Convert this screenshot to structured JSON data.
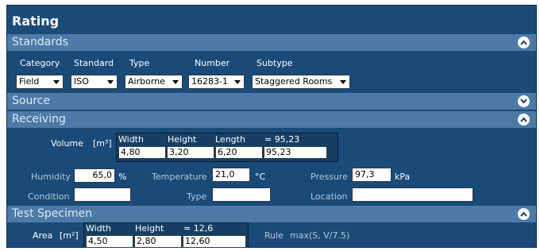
{
  "window": {
    "title": "Rating"
  },
  "standards": {
    "label": "Standards",
    "headers": {
      "category": "Category",
      "standard": "Standard",
      "type": "Type",
      "number": "Number",
      "subtype": "Subtype"
    },
    "values": {
      "category": "Field",
      "standard": "ISO",
      "type": "Airborne",
      "number": "16283-1",
      "subtype": "Staggered Rooms"
    }
  },
  "source": {
    "label": "Source"
  },
  "receiving": {
    "label": "Receiving",
    "volume": {
      "label": "Volume",
      "unit": "[m³]",
      "headers": {
        "width": "Width",
        "height": "Height",
        "length": "Length",
        "result": "= 95,23"
      },
      "values": {
        "width": "4,80",
        "height": "3,20",
        "length": "6,20",
        "result": "95,23"
      }
    },
    "humidity": {
      "label": "Humidity",
      "value": "65,0",
      "unit": "%"
    },
    "temperature": {
      "label": "Temperature",
      "value": "21,0",
      "unit": "°C"
    },
    "pressure": {
      "label": "Pressure",
      "value": "97,3",
      "unit": "kPa"
    },
    "condition": {
      "label": "Condition",
      "value": ""
    },
    "type": {
      "label": "Type",
      "value": ""
    },
    "location": {
      "label": "Location",
      "value": ""
    }
  },
  "specimen": {
    "label": "Test Specimen",
    "area": {
      "label": "Area",
      "unit": "[m²]",
      "headers": {
        "width": "Width",
        "height": "Height",
        "result": "= 12,6"
      },
      "values": {
        "width": "4,50",
        "height": "2,80",
        "result": "12,60"
      }
    },
    "rule": {
      "label": "Rule",
      "value": "max(S, V/7.5)"
    }
  }
}
